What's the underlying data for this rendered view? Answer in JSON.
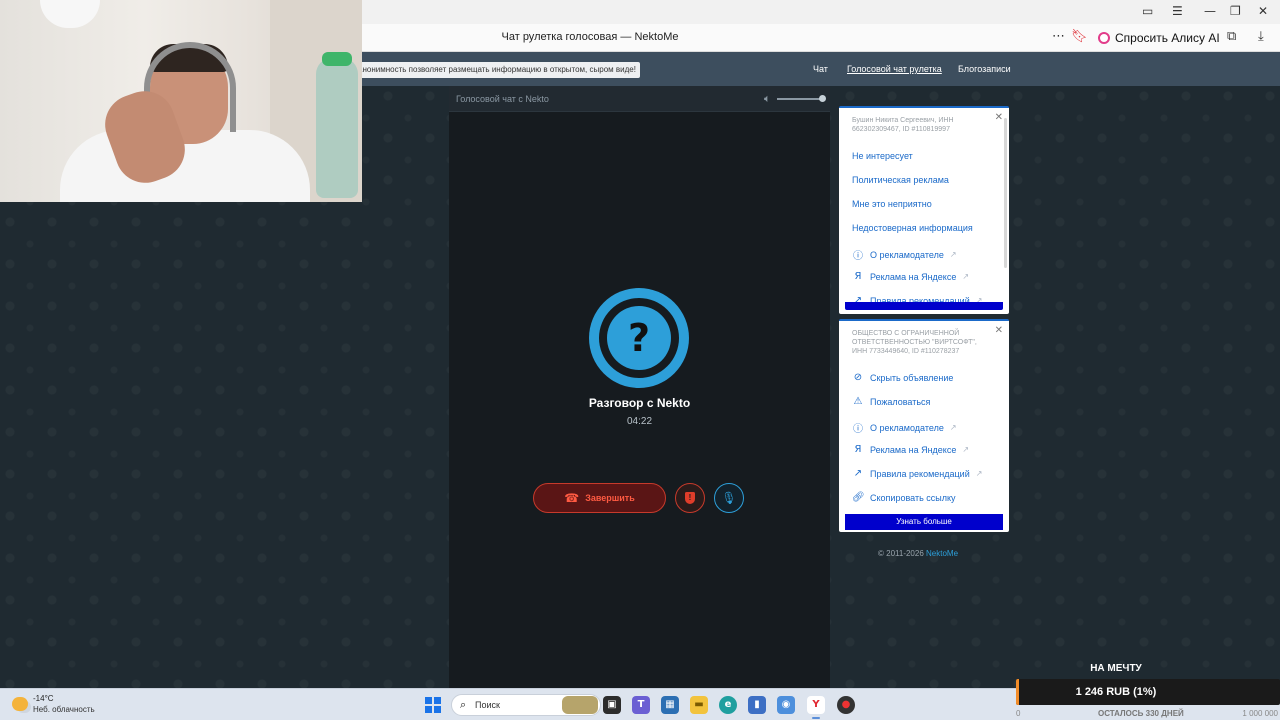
{
  "browser": {
    "page_title": "Чат рулетка голосовая — NektoMe",
    "alice_button": "Спросить Алису AI",
    "more_icon": "⋯",
    "bookmark_icon": "bookmark-icon",
    "download_icon": "download-icon"
  },
  "site": {
    "notice": "анонимность позволяет размещать информацию в открытом, сыром виде!",
    "nav": [
      "Чат",
      "Голосовой чат рулетка",
      "Блогозаписи"
    ],
    "active_nav": "Голосовой чат рулетка"
  },
  "chat": {
    "header_title": "Голосовой чат с Nekto",
    "avatar_symbol": "?",
    "call_title": "Разговор с Nekto",
    "timer": "04:22",
    "end_button": "Завершить",
    "volume_level": 0.95
  },
  "ad_menu_1": {
    "advertiser": "Бушин Никита Сергеевич, ИНН 662302309467, ID #110819997",
    "items": [
      {
        "label": "Не интересует",
        "icon": ""
      },
      {
        "label": "Политическая реклама",
        "icon": ""
      },
      {
        "label": "Мне это неприятно",
        "icon": ""
      },
      {
        "label": "Недостоверная информация",
        "icon": ""
      },
      {
        "label": "О рекламодателе",
        "icon": "info-icon"
      },
      {
        "label": "Реклама на Яндексе",
        "icon": "yandex-icon"
      },
      {
        "label": "Правила рекомендаций",
        "icon": "arrow-icon"
      }
    ]
  },
  "ad_menu_2": {
    "advertiser": "ОБЩЕСТВО С ОГРАНИЧЕННОЙ ОТВЕТСТВЕННОСТЬЮ \"ВИРТСОФТ\", ИНН 7733449640, ID #110278237",
    "items": [
      {
        "label": "Скрыть объявление",
        "icon": "eye-off-icon"
      },
      {
        "label": "Пожаловаться",
        "icon": "warning-icon"
      },
      {
        "label": "О рекламодателе",
        "icon": "info-icon"
      },
      {
        "label": "Реклама на Яндексе",
        "icon": "yandex-icon"
      },
      {
        "label": "Правила рекомендаций",
        "icon": "arrow-icon"
      },
      {
        "label": "Скопировать ссылку",
        "icon": "link-icon"
      }
    ],
    "learn_more": "Узнать больше"
  },
  "footer": {
    "copyright": "© 2011-2026",
    "brand": "NektoMe"
  },
  "taskbar": {
    "temperature": "-14°C",
    "weather": "Неб. облачность",
    "search_placeholder": "Поиск"
  },
  "donation": {
    "title": "НА МЕЧТУ",
    "amount": "1 246 RUB (1%)",
    "progress_percent": 1,
    "start": "0",
    "remaining": "ОСТАЛОСЬ 330 ДНЕЙ",
    "goal": "1 000 000"
  },
  "colors": {
    "accent": "#2d9fd9",
    "danger": "#e03d2a",
    "ad_link": "#1b6ac9",
    "ad_button": "#0000cc",
    "donation_fill": "#f28c28"
  }
}
